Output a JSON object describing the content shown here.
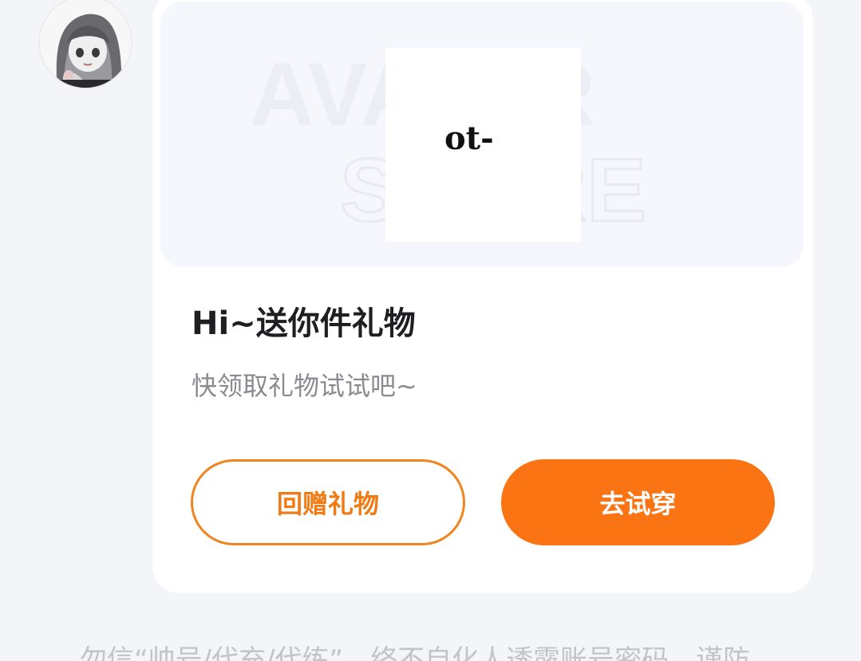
{
  "gift_card": {
    "title": "Hi~送你件礼物",
    "subtitle": "快领取礼物试试吧~",
    "banner_watermark_line1": "AVATAR",
    "banner_watermark_line2": "STORE",
    "gift_image_text": "ot-"
  },
  "buttons": {
    "return_gift": "回赠礼物",
    "try_on": "去试穿"
  },
  "footer_note": "勿信“帅号/代充/代练”，络不自化人透露账号密码，谨防",
  "colors": {
    "accent": "#fb7414",
    "outline": "#f0851f",
    "background": "#f4f5f9",
    "title": "#1f1f23",
    "subtitle": "#8a8b90"
  },
  "icons": {
    "avatar": "anime-girl-avatar"
  }
}
